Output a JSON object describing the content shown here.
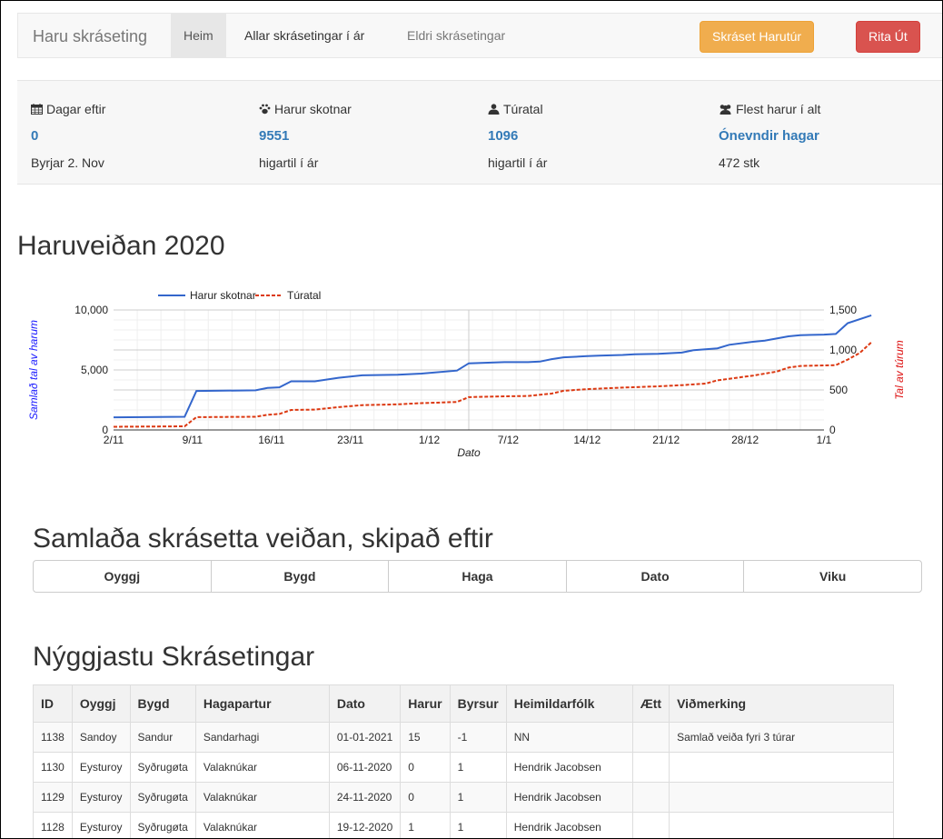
{
  "nav": {
    "brand": "Haru skráseting",
    "home": "Heim",
    "all": "Allar skrásetingar í ár",
    "older": "Eldri skrásetingar",
    "register_btn": "Skráset Harutúr",
    "logout_btn": "Rita Út"
  },
  "stats": [
    {
      "icon": "calendar-icon",
      "label": "Dagar eftir",
      "value": "0",
      "sub": "Byrjar 2. Nov"
    },
    {
      "icon": "paw-icon",
      "label": "Harur skotnar",
      "value": "9551",
      "sub": "higartil í ár"
    },
    {
      "icon": "user-icon",
      "label": "Túratal",
      "value": "1096",
      "sub": "higartil í ár"
    },
    {
      "icon": "users-icon",
      "label": "Flest harur í alt",
      "value": "Ónevndir hagar",
      "sub": "472 stk"
    }
  ],
  "chart_title": "Haruveiðan 2020",
  "chart_data": {
    "type": "line",
    "xlabel": "Dato",
    "ylabel_left": "Samlað tal av harum",
    "ylabel_right": "Tal av túrum",
    "x_ticks": [
      "2/11",
      "9/11",
      "16/11",
      "23/11",
      "1/12",
      "7/12",
      "14/12",
      "21/12",
      "28/12",
      "1/1"
    ],
    "y_left_ticks": [
      "0",
      "5,000",
      "10,000"
    ],
    "y_right_ticks": [
      "0",
      "500",
      "1,000",
      "1,500"
    ],
    "ylim_left": [
      0,
      10000
    ],
    "ylim_right": [
      0,
      1500
    ],
    "xlim_days": [
      0,
      60
    ],
    "legend_position": "top",
    "series": [
      {
        "name": "Harur skotnar",
        "axis": "left",
        "color": "#3366cc",
        "points": [
          [
            0,
            1050
          ],
          [
            6,
            1100
          ],
          [
            7,
            3250
          ],
          [
            12,
            3300
          ],
          [
            13,
            3500
          ],
          [
            14,
            3550
          ],
          [
            15,
            4050
          ],
          [
            17,
            4050
          ],
          [
            19,
            4350
          ],
          [
            21,
            4550
          ],
          [
            24,
            4600
          ],
          [
            26,
            4700
          ],
          [
            29,
            4950
          ],
          [
            30,
            5550
          ],
          [
            33,
            5650
          ],
          [
            35,
            5650
          ],
          [
            36,
            5700
          ],
          [
            37,
            5900
          ],
          [
            38,
            6050
          ],
          [
            40,
            6150
          ],
          [
            41,
            6200
          ],
          [
            43,
            6250
          ],
          [
            44,
            6300
          ],
          [
            46,
            6350
          ],
          [
            48,
            6450
          ],
          [
            49,
            6650
          ],
          [
            51,
            6800
          ],
          [
            52,
            7100
          ],
          [
            54,
            7350
          ],
          [
            55,
            7450
          ],
          [
            57,
            7800
          ],
          [
            58,
            7900
          ],
          [
            60,
            7950
          ],
          [
            61,
            8000
          ],
          [
            62,
            8900
          ],
          [
            64,
            9551
          ]
        ]
      },
      {
        "name": "Túratal",
        "axis": "right",
        "color": "#dc3912",
        "points": [
          [
            0,
            40
          ],
          [
            6,
            45
          ],
          [
            7,
            160
          ],
          [
            12,
            165
          ],
          [
            13,
            190
          ],
          [
            14,
            200
          ],
          [
            15,
            250
          ],
          [
            17,
            255
          ],
          [
            19,
            285
          ],
          [
            21,
            310
          ],
          [
            24,
            320
          ],
          [
            26,
            335
          ],
          [
            29,
            350
          ],
          [
            30,
            410
          ],
          [
            33,
            420
          ],
          [
            35,
            425
          ],
          [
            37,
            455
          ],
          [
            38,
            490
          ],
          [
            40,
            510
          ],
          [
            43,
            530
          ],
          [
            46,
            545
          ],
          [
            48,
            560
          ],
          [
            50,
            580
          ],
          [
            51,
            620
          ],
          [
            52,
            640
          ],
          [
            54,
            680
          ],
          [
            56,
            730
          ],
          [
            57,
            780
          ],
          [
            58,
            800
          ],
          [
            61,
            810
          ],
          [
            62,
            880
          ],
          [
            63,
            960
          ],
          [
            64,
            1096
          ]
        ]
      }
    ]
  },
  "summary_title": "Samlaða skrásetta veiðan, skipað eftir",
  "sort_buttons": [
    "Oyggj",
    "Bygd",
    "Haga",
    "Dato",
    "Viku"
  ],
  "latest_title": "Nýggjastu Skrásetingar",
  "table": {
    "headers": [
      "ID",
      "Oyggj",
      "Bygd",
      "Hagapartur",
      "Dato",
      "Harur",
      "Byrsur",
      "Heimildarfólk",
      "Ætt",
      "Viðmerking"
    ],
    "rows": [
      [
        "1138",
        "Sandoy",
        "Sandur",
        "Sandarhagi",
        "01-01-2021",
        "15",
        "-1",
        "NN",
        "",
        "Samlað veiða fyri 3 túrar"
      ],
      [
        "1130",
        "Eysturoy",
        "Syðrugøta",
        "Valaknúkar",
        "06-11-2020",
        "0",
        "1",
        "Hendrik Jacobsen",
        "",
        ""
      ],
      [
        "1129",
        "Eysturoy",
        "Syðrugøta",
        "Valaknúkar",
        "24-11-2020",
        "0",
        "1",
        "Hendrik Jacobsen",
        "",
        ""
      ],
      [
        "1128",
        "Eysturoy",
        "Syðrugøta",
        "Valaknúkar",
        "19-12-2020",
        "1",
        "1",
        "Hendrik Jacobsen",
        "",
        ""
      ]
    ]
  }
}
